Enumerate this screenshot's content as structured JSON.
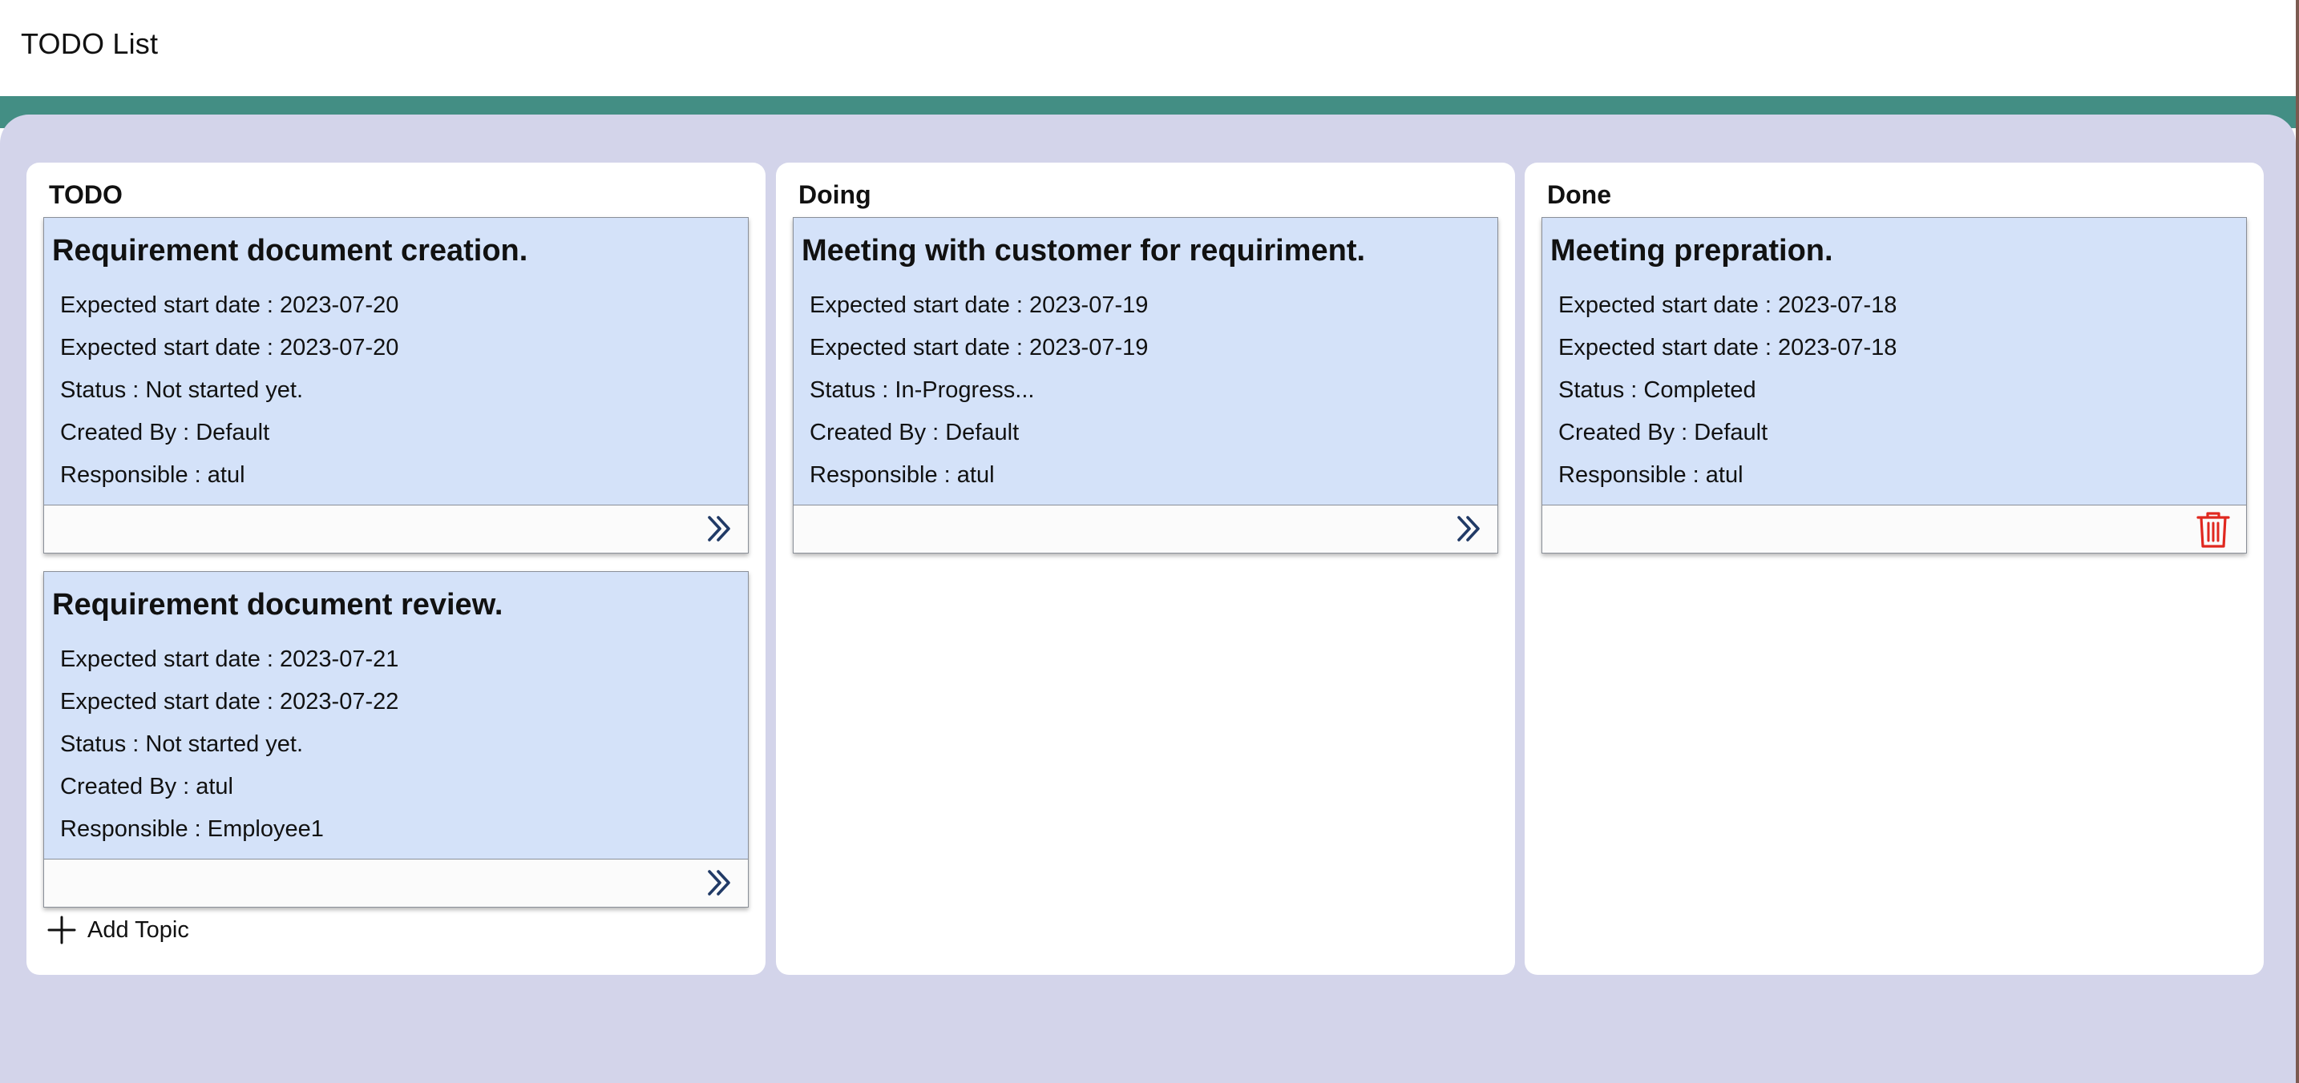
{
  "app": {
    "title": "TODO List"
  },
  "colors": {
    "accent_band": "#438e84",
    "board_bg": "#d3d4ea",
    "card_bg": "#d4e2f9",
    "move_icon": "#213a66",
    "delete_icon": "#e0281f"
  },
  "columns": [
    {
      "title": "TODO",
      "cards": [
        {
          "title": "Requirement document creation.",
          "fields": [
            "Expected start date : 2023-07-20",
            "Expected start date : 2023-07-20",
            "Status : Not started yet.",
            "Created By : Default",
            "Responsible : atul"
          ],
          "action_icon": "double-chevron-right-icon"
        },
        {
          "title": "Requirement document review.",
          "fields": [
            "Expected start date : 2023-07-21",
            "Expected start date : 2023-07-22",
            "Status : Not started yet.",
            "Created By : atul",
            "Responsible : Employee1"
          ],
          "action_icon": "double-chevron-right-icon"
        }
      ],
      "add_label": "Add Topic",
      "add_icon": "plus-icon"
    },
    {
      "title": "Doing",
      "cards": [
        {
          "title": "Meeting with customer for requiriment.",
          "fields": [
            "Expected start date : 2023-07-19",
            "Expected start date : 2023-07-19",
            "Status : In-Progress...",
            "Created By : Default",
            "Responsible : atul"
          ],
          "action_icon": "double-chevron-right-icon"
        }
      ]
    },
    {
      "title": "Done",
      "cards": [
        {
          "title": "Meeting prepration.",
          "fields": [
            "Expected start date : 2023-07-18",
            "Expected start date : 2023-07-18",
            "Status : Completed",
            "Created By : Default",
            "Responsible : atul"
          ],
          "action_icon": "trash-icon"
        }
      ]
    }
  ]
}
